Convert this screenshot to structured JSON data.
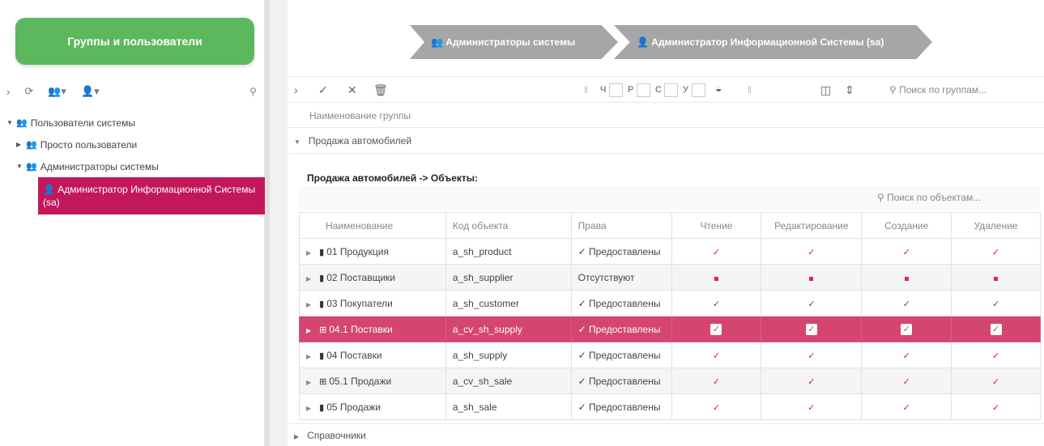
{
  "left": {
    "groups_button": "Группы и пользователи",
    "tree": [
      {
        "label": "Пользователи системы",
        "level": 0,
        "expanded": true
      },
      {
        "label": "Просто пользователи",
        "level": 1,
        "expanded": false
      },
      {
        "label": "Администраторы системы",
        "level": 1,
        "expanded": true
      }
    ],
    "selected_user": "Администратор Информационной Системы (sa)"
  },
  "breadcrumbs": {
    "crumb1": "Администраторы системы",
    "crumb2": "Администратор Информационной Системы (sa)"
  },
  "toolbar": {
    "perm_r": "Ч",
    "perm_e": "Р",
    "perm_c": "С",
    "perm_d": "У",
    "search_placeholder": "Поиск по группам..."
  },
  "grid": {
    "column_header": "Наименование группы",
    "group_name": "Продажа автомобилей",
    "objects_title": "Продажа автомобилей -> Объекты:",
    "objects_search": "Поиск по объектам...",
    "footer_group": "Справочники"
  },
  "table": {
    "headers": [
      "Наименование",
      "Код объекта",
      "Права",
      "Чтение",
      "Редактирование",
      "Создание",
      "Удаление"
    ],
    "rows": [
      {
        "name": "01 Продукция",
        "code": "a_sh_product",
        "rights": "✓ Предоставлены"
      },
      {
        "name": "02 Поставщики",
        "code": "a_sh_supplier",
        "rights": "Отсутствуют"
      },
      {
        "name": "03 Покупатели",
        "code": "a_sh_customer",
        "rights": "✓ Предоставлены"
      },
      {
        "name": "04.1 Поставки",
        "code": "a_cv_sh_supply",
        "rights": "✓ Предоставлены"
      },
      {
        "name": "04 Поставки",
        "code": "a_sh_supply",
        "rights": "✓ Предоставлены"
      },
      {
        "name": "05.1 Продажи",
        "code": "a_cv_sh_sale",
        "rights": "✓ Предоставлены"
      },
      {
        "name": "05 Продажи",
        "code": "a_sh_sale",
        "rights": "✓ Предоставлены"
      }
    ]
  }
}
